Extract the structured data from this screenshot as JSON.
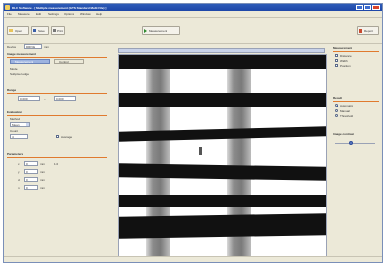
{
  "window": {
    "title": "DLC Software - [ Multiple measurement (GTS Standard Multi File) ]",
    "controls": [
      "_",
      "□",
      "×"
    ]
  },
  "menu": [
    "File",
    "Measure",
    "Edit",
    "Settings",
    "Options",
    "Window",
    "Help"
  ],
  "toolbar": {
    "open_label": "Open",
    "save_label": "Save",
    "print_label": "Print",
    "measure_label": "Measurement",
    "report_label": "Report"
  },
  "left": {
    "device_label": "Device",
    "device_value": "DRIVE",
    "device_unit": "mm",
    "section1_title": "Image measurement",
    "tab_active": "Measurement",
    "tab_inactive": "Control",
    "mode_label": "Mode",
    "mode_value": "Subpixel edge",
    "section2_title": "Range",
    "range_from": "0.000",
    "range_to": "0.000",
    "section3_title": "Evaluation",
    "eval_method_label": "Method",
    "eval_method": "Mean",
    "eval_count_label": "Count",
    "eval_count": "4",
    "eval_checkbox": "Average",
    "section4_title": "Parameters",
    "param_rows": [
      {
        "label": "x",
        "value": "0",
        "unit": "mm",
        "extra": "1.0"
      },
      {
        "label": "y",
        "value": "0",
        "unit": "mm",
        "extra": ""
      },
      {
        "label": "d",
        "value": "0",
        "unit": "mm",
        "extra": ""
      },
      {
        "label": "n",
        "value": "0",
        "unit": "mm",
        "extra": ""
      }
    ]
  },
  "right": {
    "section1_title": "Measurement",
    "opt1": "Distance",
    "opt2": "Width",
    "opt3": "Position",
    "section2_title": "Result",
    "res1": "Automatic",
    "res2": "Manual",
    "res3": "Threshold",
    "section3_title": "Image contrast"
  },
  "colors": {
    "titlebar": "#1d46a8",
    "accent": "#e07a2e",
    "bar": "#111111"
  }
}
